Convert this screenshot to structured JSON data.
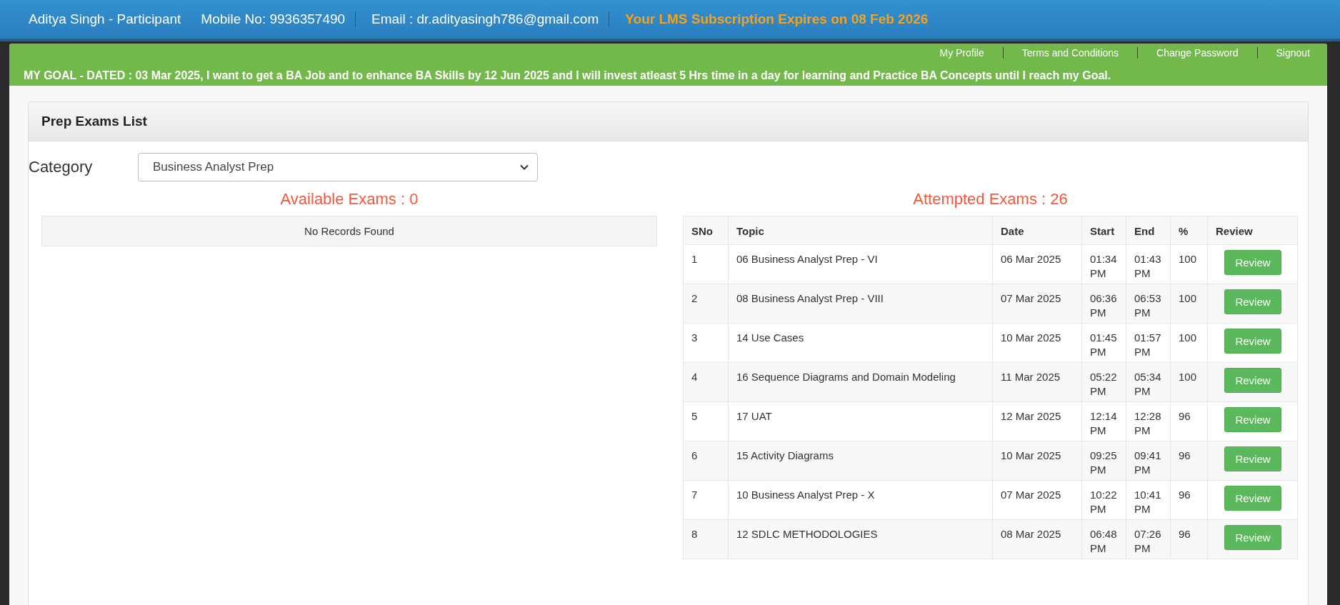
{
  "header": {
    "user": "Aditya Singh - Participant",
    "mobile": "Mobile No: 9936357490",
    "email": "Email : dr.adityasingh786@gmail.com",
    "subscription": "Your LMS Subscription Expires on 08 Feb 2026"
  },
  "nav": [
    "My Profile",
    "Terms and Conditions",
    "Change Password",
    "Signout"
  ],
  "goal": "MY GOAL - DATED : 03 Mar 2025, I want to get a BA Job and to enhance BA Skills by 12 Jun 2025 and I will invest atleast 5 Hrs time in a day for learning and Practice BA Concepts until I reach my Goal.",
  "panel": {
    "title": "Prep Exams List",
    "category": {
      "label": "Category",
      "value": "Business Analyst Prep"
    },
    "available": {
      "heading": "Available Exams : 0",
      "empty": "No Records Found"
    },
    "attempted": {
      "heading": "Attempted Exams : 26",
      "columns": [
        "SNo",
        "Topic",
        "Date",
        "Start",
        "End",
        "%",
        "Review"
      ],
      "rows": [
        {
          "sno": "1",
          "topic": "06 Business Analyst Prep - VI",
          "date": "06 Mar 2025",
          "start": "01:34 PM",
          "end": "01:43 PM",
          "pct": "100",
          "action": "Review"
        },
        {
          "sno": "2",
          "topic": "08 Business Analyst Prep - VIII",
          "date": "07 Mar 2025",
          "start": "06:36 PM",
          "end": "06:53 PM",
          "pct": "100",
          "action": "Review"
        },
        {
          "sno": "3",
          "topic": "14 Use Cases",
          "date": "10 Mar 2025",
          "start": "01:45 PM",
          "end": "01:57 PM",
          "pct": "100",
          "action": "Review"
        },
        {
          "sno": "4",
          "topic": "16 Sequence Diagrams and Domain Modeling",
          "date": "11 Mar 2025",
          "start": "05:22 PM",
          "end": "05:34 PM",
          "pct": "100",
          "action": "Review"
        },
        {
          "sno": "5",
          "topic": "17 UAT",
          "date": "12 Mar 2025",
          "start": "12:14 PM",
          "end": "12:28 PM",
          "pct": "96",
          "action": "Review"
        },
        {
          "sno": "6",
          "topic": "15 Activity Diagrams",
          "date": "10 Mar 2025",
          "start": "09:25 PM",
          "end": "09:41 PM",
          "pct": "96",
          "action": "Review"
        },
        {
          "sno": "7",
          "topic": "10 Business Analyst Prep - X",
          "date": "07 Mar 2025",
          "start": "10:22 PM",
          "end": "10:41 PM",
          "pct": "96",
          "action": "Review"
        },
        {
          "sno": "8",
          "topic": "12 SDLC METHODOLOGIES",
          "date": "08 Mar 2025",
          "start": "06:48 PM",
          "end": "07:26 PM",
          "pct": "96",
          "action": "Review"
        }
      ]
    }
  }
}
